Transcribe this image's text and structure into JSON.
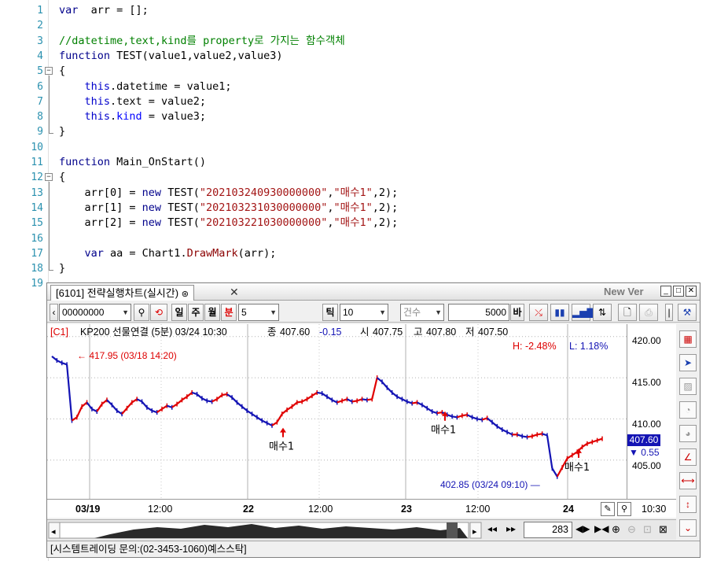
{
  "editor": {
    "lines": [
      {
        "n": "1",
        "segments": [
          [
            "kw",
            "var"
          ],
          [
            "",
            "  arr = [];"
          ]
        ]
      },
      {
        "n": "2",
        "segments": []
      },
      {
        "n": "3",
        "segments": [
          [
            "cm",
            "//datetime,text,kind를 property로 가지는 함수객체"
          ]
        ]
      },
      {
        "n": "4",
        "segments": [
          [
            "kw",
            "function"
          ],
          [
            "",
            " TEST(value1,value2,value3)"
          ]
        ]
      },
      {
        "n": "5",
        "segments": [
          [
            "",
            "{"
          ]
        ]
      },
      {
        "n": "6",
        "segments": [
          [
            "",
            "    "
          ],
          [
            "kwb",
            "this"
          ],
          [
            "",
            ".datetime = value1;"
          ]
        ]
      },
      {
        "n": "7",
        "segments": [
          [
            "",
            "    "
          ],
          [
            "kwb",
            "this"
          ],
          [
            "",
            ".text = value2;"
          ]
        ]
      },
      {
        "n": "8",
        "segments": [
          [
            "",
            "    "
          ],
          [
            "kwb",
            "this"
          ],
          [
            "",
            "."
          ],
          [
            "blue",
            "kind"
          ],
          [
            "",
            " = value3;"
          ]
        ]
      },
      {
        "n": "9",
        "segments": [
          [
            "",
            "}"
          ]
        ]
      },
      {
        "n": "10",
        "segments": []
      },
      {
        "n": "11",
        "segments": [
          [
            "kw",
            "function"
          ],
          [
            "",
            " Main_OnStart()"
          ]
        ]
      },
      {
        "n": "12",
        "segments": [
          [
            "",
            "{"
          ]
        ]
      },
      {
        "n": "13",
        "segments": [
          [
            "",
            "    arr[0] = "
          ],
          [
            "kw",
            "new"
          ],
          [
            "",
            " TEST("
          ],
          [
            "str",
            "\"202103240930000000\""
          ],
          [
            "",
            ","
          ],
          [
            "str",
            "\"매수1\""
          ],
          [
            "",
            ",2);"
          ]
        ]
      },
      {
        "n": "14",
        "segments": [
          [
            "",
            "    arr[1] = "
          ],
          [
            "kw",
            "new"
          ],
          [
            "",
            " TEST("
          ],
          [
            "str",
            "\"202103231030000000\""
          ],
          [
            "",
            ","
          ],
          [
            "str",
            "\"매수1\""
          ],
          [
            "",
            ",2);"
          ]
        ]
      },
      {
        "n": "15",
        "segments": [
          [
            "",
            "    arr[2] = "
          ],
          [
            "kw",
            "new"
          ],
          [
            "",
            " TEST("
          ],
          [
            "str",
            "\"202103221030000000\""
          ],
          [
            "",
            ","
          ],
          [
            "str",
            "\"매수1\""
          ],
          [
            "",
            ",2);"
          ]
        ]
      },
      {
        "n": "16",
        "segments": []
      },
      {
        "n": "17",
        "segments": [
          [
            "",
            "    "
          ],
          [
            "kw",
            "var"
          ],
          [
            "",
            " aa = Chart1."
          ],
          [
            "fn",
            "DrawMark"
          ],
          [
            "",
            "(arr);"
          ]
        ]
      },
      {
        "n": "18",
        "segments": [
          [
            "",
            "}"
          ]
        ]
      },
      {
        "n": "19",
        "segments": []
      }
    ]
  },
  "chart_window": {
    "tab_title": "[6101] 전략실행차트(실시간)",
    "new_ver": "New Ver",
    "toolbar": {
      "code_value": "00000000",
      "period_day": "일",
      "period_week": "주",
      "period_month": "월",
      "period_minute": "분",
      "minute_value": "5",
      "tick_label": "틱",
      "tick_value": "10",
      "count_label": "건수",
      "count_value": "5000",
      "bar_label": "바"
    },
    "info": {
      "code": "[C1]",
      "name": "KP200 선물연결 (5분) 03/24 10:30",
      "close_label": "종",
      "close": "407.60",
      "change": "-0.15",
      "open_label": "시",
      "open": "407.75",
      "high_label": "고",
      "high": "407.80",
      "low_label": "저",
      "low": "407.50",
      "high_pct": "H: -2.48%",
      "low_pct": "L: 1.18%"
    },
    "annotations": {
      "max_label": "417.95 (03/18 14:20)",
      "min_label": "402.85 (03/24 09:10)",
      "marks": [
        "매수1",
        "매수1",
        "매수1"
      ]
    },
    "price_badge": "407.60",
    "change_badge": "▼ 0.55",
    "scroll_value": "283",
    "status": "[시스템트레이딩 문의:(02-3453-1060)예스스탁]",
    "colors": {
      "up": "#e00000",
      "down": "#1414b4",
      "mark": "#e00000"
    }
  },
  "chart_data": {
    "type": "line",
    "title": "",
    "x_ticks": [
      "03/19",
      "12:00",
      "22",
      "12:00",
      "23",
      "12:00",
      "24",
      "10:30"
    ],
    "y_ticks": [
      "420.00",
      "415.00",
      "410.00",
      "405.00"
    ],
    "ylim": [
      400.3,
      421.5
    ],
    "series": [
      {
        "values": [
          417.6,
          417.1,
          416.8,
          416.6,
          409.8,
          410.2,
          411.5,
          412.0,
          411.2,
          410.9,
          411.8,
          412.3,
          411.7,
          411.0,
          410.6,
          411.3,
          412.0,
          412.4,
          412.1,
          411.4,
          411.0,
          410.8,
          411.2,
          411.6,
          411.4,
          411.8,
          412.3,
          412.7,
          413.2,
          413.0,
          412.5,
          412.2,
          412.1,
          412.4,
          412.9,
          413.0,
          412.6,
          412.0,
          411.5,
          411.0,
          410.6,
          410.2,
          409.8,
          409.5,
          409.2,
          409.6,
          410.6,
          411.1,
          411.5,
          412.0,
          412.1,
          412.4,
          412.8,
          413.2,
          413.1,
          412.7,
          412.3,
          412.0,
          412.2,
          412.4,
          412.1,
          412.2,
          412.4,
          412.3,
          412.4,
          415.0,
          414.5,
          413.8,
          413.2,
          412.7,
          412.4,
          412.1,
          411.9,
          412.0,
          411.7,
          411.3,
          410.9,
          410.7,
          410.8,
          410.5,
          410.3,
          410.2,
          410.4,
          410.5,
          410.2,
          410.0,
          409.9,
          410.1,
          409.6,
          409.1,
          408.7,
          408.4,
          408.1,
          408.1,
          407.9,
          407.8,
          407.9,
          408.1,
          408.2,
          408.0,
          404.0,
          403.0,
          404.1,
          405.2,
          405.6,
          406.0,
          406.6,
          407.0,
          407.2,
          407.4,
          407.6
        ]
      }
    ],
    "buy_marks": [
      {
        "date": "03/22 10:30",
        "text": "매수1",
        "price": 409.5
      },
      {
        "date": "03/23 10:30",
        "text": "매수1",
        "price": 411.5
      },
      {
        "date": "03/24 09:30",
        "text": "매수1",
        "price": 407.0
      }
    ],
    "max": {
      "price": 417.95,
      "date": "03/18 14:20"
    },
    "min": {
      "price": 402.85,
      "date": "03/24 09:10"
    },
    "grid": true
  }
}
